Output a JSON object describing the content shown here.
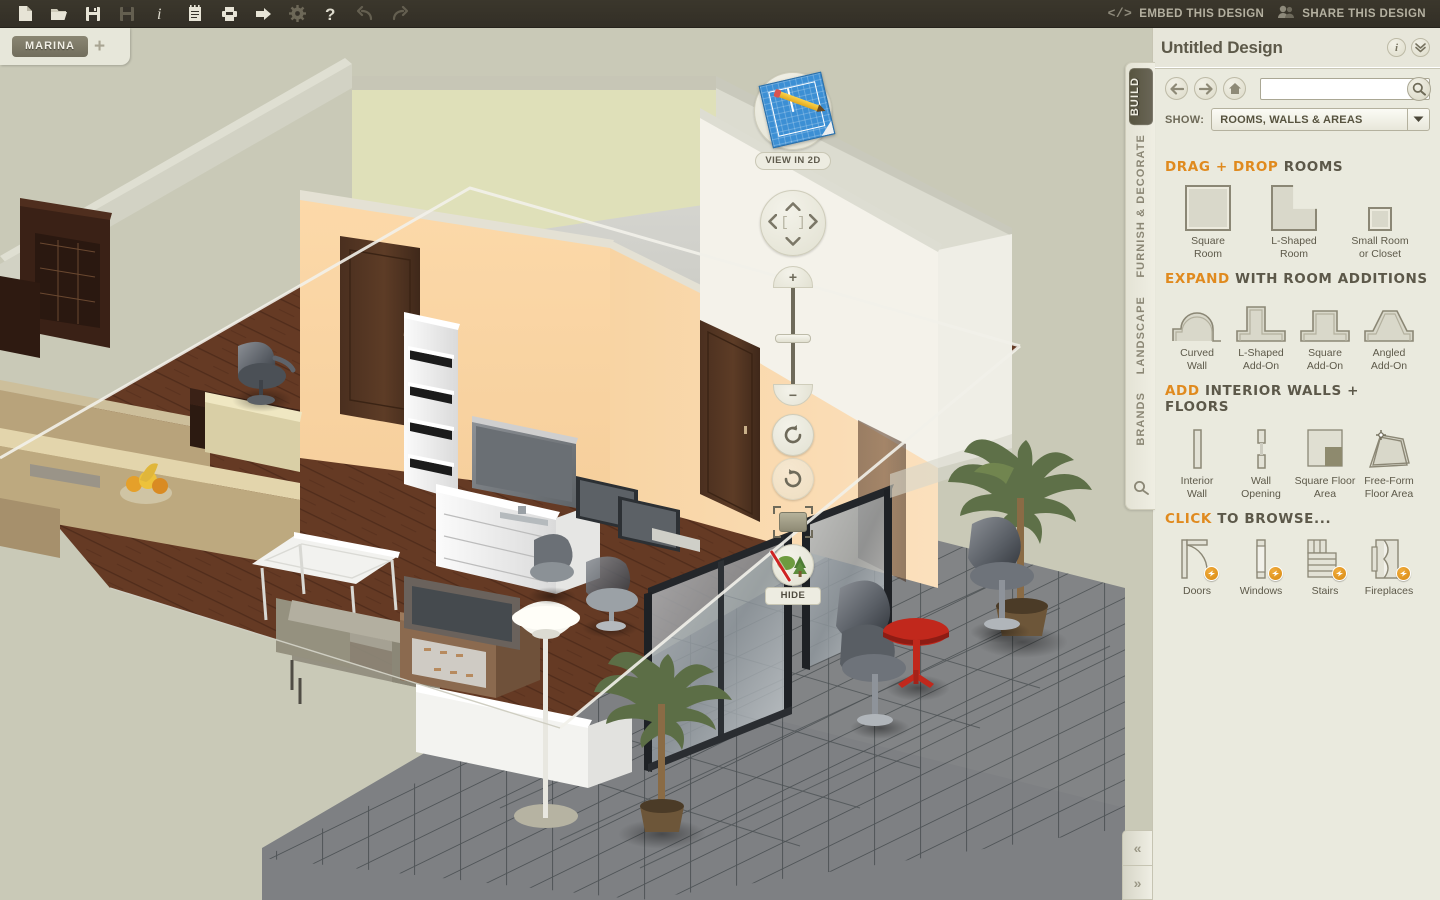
{
  "toolbar": {
    "icons": [
      {
        "name": "new-file-icon",
        "label": "New"
      },
      {
        "name": "open-folder-icon",
        "label": "Open"
      },
      {
        "name": "save-icon",
        "label": "Save"
      },
      {
        "name": "save-as-icon",
        "label": "Save As"
      },
      {
        "name": "info-icon",
        "label": "Info"
      },
      {
        "name": "notes-icon",
        "label": "Notes"
      },
      {
        "name": "print-icon",
        "label": "Print"
      },
      {
        "name": "export-icon",
        "label": "Export"
      },
      {
        "name": "settings-gear-icon",
        "label": "Settings"
      },
      {
        "name": "help-icon",
        "label": "Help"
      },
      {
        "name": "undo-icon",
        "label": "Undo"
      },
      {
        "name": "redo-icon",
        "label": "Redo"
      }
    ],
    "embed_label": "EMBED THIS DESIGN",
    "share_label": "SHARE THIS DESIGN"
  },
  "tabbar": {
    "tabs": [
      "MARINA"
    ],
    "add_label": "+"
  },
  "viewport": {
    "view_2d_label": "VIEW IN 2D",
    "pan": {
      "up": "⌃",
      "down": "⌄",
      "left": "‹",
      "right": "›",
      "center": "[ ]"
    },
    "zoom": {
      "plus": "+",
      "minus": "−"
    },
    "hide_label": "HIDE"
  },
  "rail": {
    "tabs": [
      {
        "label": "BUILD",
        "active": true
      },
      {
        "label": "FURNISH & DECORATE",
        "active": false
      },
      {
        "label": "LANDSCAPE",
        "active": false
      },
      {
        "label": "BRANDS",
        "active": false
      }
    ],
    "search_icon": "search-icon"
  },
  "panel": {
    "title": "Untitled Design",
    "header_icons": [
      {
        "name": "info-icon",
        "glyph": "i"
      },
      {
        "name": "collapse-chevrons-icon",
        "glyph": "»"
      }
    ],
    "nav": {
      "back": "←",
      "forward": "→",
      "home": "home-icon"
    },
    "search": {
      "value": "",
      "placeholder": ""
    },
    "show": {
      "label": "SHOW:",
      "selected": "ROOMS, WALLS & AREAS",
      "options": [
        "ROOMS, WALLS & AREAS"
      ]
    },
    "sections": [
      {
        "id": "drag-drop-rooms",
        "title_hl": "DRAG + DROP",
        "title_rest": " ROOMS",
        "items": [
          {
            "name": "square-room",
            "label_line1": "Square",
            "label_line2": "Room"
          },
          {
            "name": "l-shaped-room",
            "label_line1": "L-Shaped",
            "label_line2": "Room"
          },
          {
            "name": "small-room-or-closet",
            "label_line1": "Small Room",
            "label_line2": "or Closet"
          }
        ]
      },
      {
        "id": "room-additions",
        "title_hl": "EXPAND",
        "title_rest": " WITH ROOM ADDITIONS",
        "items": [
          {
            "name": "curved-wall",
            "label_line1": "Curved",
            "label_line2": "Wall"
          },
          {
            "name": "l-shaped-add-on",
            "label_line1": "L-Shaped",
            "label_line2": "Add-On"
          },
          {
            "name": "square-add-on",
            "label_line1": "Square",
            "label_line2": "Add-On"
          },
          {
            "name": "angled-add-on",
            "label_line1": "Angled",
            "label_line2": "Add-On"
          }
        ]
      },
      {
        "id": "interior-walls-floors",
        "title_hl": "ADD",
        "title_rest": " INTERIOR WALLS + FLOORS",
        "items": [
          {
            "name": "interior-wall",
            "label_line1": "Interior",
            "label_line2": "Wall"
          },
          {
            "name": "wall-opening",
            "label_line1": "Wall",
            "label_line2": "Opening"
          },
          {
            "name": "square-floor-area",
            "label_line1": "Square Floor",
            "label_line2": "Area"
          },
          {
            "name": "free-form-floor-area",
            "label_line1": "Free-Form",
            "label_line2": "Floor Area"
          }
        ]
      },
      {
        "id": "click-to-browse",
        "title_hl": "CLICK",
        "title_rest": " TO BROWSE...",
        "items": [
          {
            "name": "doors",
            "label_line1": "Doors",
            "label_line2": ""
          },
          {
            "name": "windows",
            "label_line1": "Windows",
            "label_line2": ""
          },
          {
            "name": "stairs",
            "label_line1": "Stairs",
            "label_line2": ""
          },
          {
            "name": "fireplaces",
            "label_line1": "Fireplaces",
            "label_line2": ""
          }
        ]
      }
    ]
  },
  "collapse": {
    "prev": "«",
    "next": "»"
  },
  "colors": {
    "toolbar_bg": "#36322a",
    "canvas_bg": "#c9c9b7",
    "panel_bg": "#eaeade",
    "accent_orange": "#e08a1e",
    "tab_active": "#5b5744",
    "text_dark": "#5d5949"
  }
}
